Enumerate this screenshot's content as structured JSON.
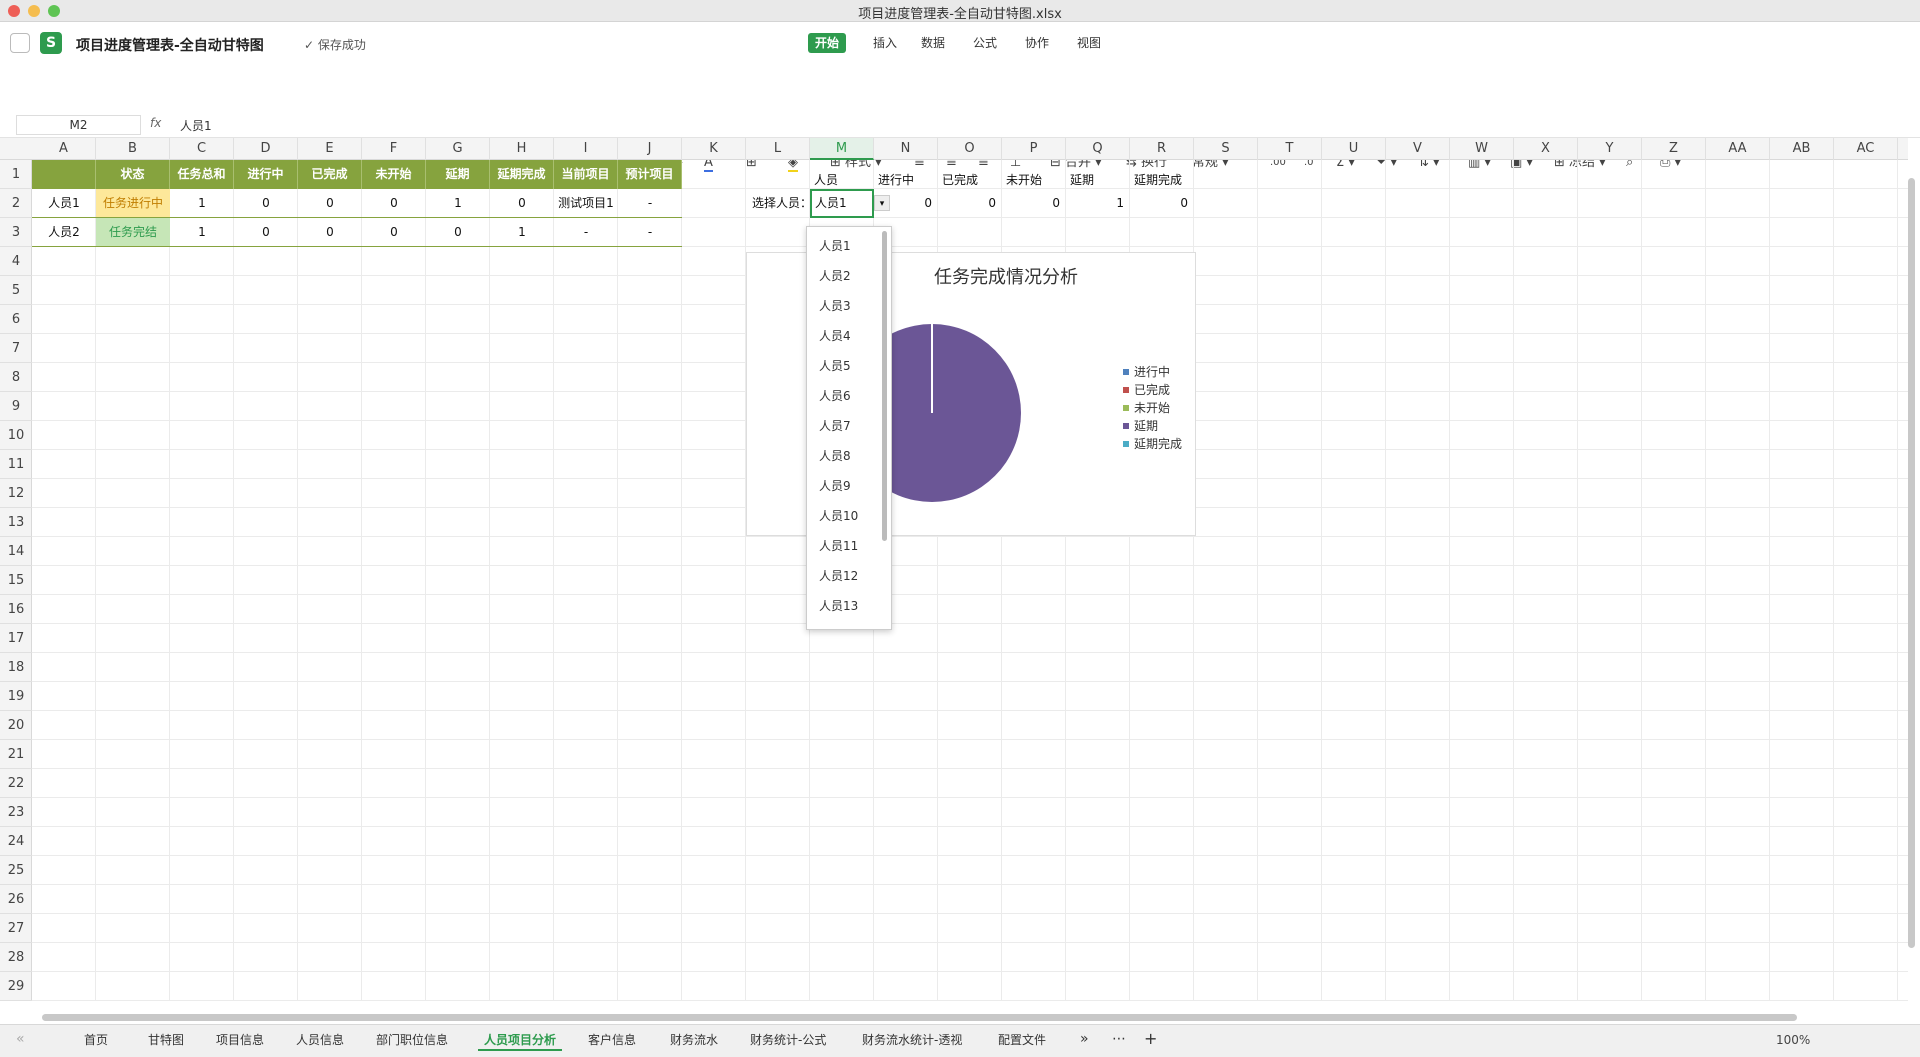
{
  "window": {
    "title": "项目进度管理表-全自动甘特图.xlsx"
  },
  "app": {
    "doc_title": "项目进度管理表-全自动甘特图",
    "save_status": "保存成功",
    "logo": "S"
  },
  "menu_tabs": [
    "开始",
    "插入",
    "数据",
    "公式",
    "协作",
    "视图"
  ],
  "toolbar": {
    "font": "Arial",
    "size": "10",
    "style_label": "样式",
    "merge_label": "合并",
    "wrap_label": "换行",
    "format": "常规",
    "freeze_label": "冻结"
  },
  "formula": {
    "cell": "M2",
    "fx": "fx",
    "value": "人员1"
  },
  "columns": [
    "A",
    "B",
    "C",
    "D",
    "E",
    "F",
    "G",
    "H",
    "I",
    "J",
    "K",
    "L",
    "M",
    "N",
    "O",
    "P",
    "Q",
    "R",
    "S",
    "T",
    "U",
    "V",
    "W",
    "X",
    "Y",
    "Z",
    "AA",
    "AB",
    "AC"
  ],
  "rows": [
    "1",
    "2",
    "3",
    "4",
    "5",
    "6",
    "7",
    "8",
    "9",
    "10",
    "11",
    "12",
    "13",
    "14",
    "15",
    "16",
    "17",
    "18",
    "19",
    "20",
    "21",
    "22",
    "23",
    "24",
    "25",
    "26",
    "27",
    "28",
    "29"
  ],
  "table": {
    "headers": [
      "",
      "状态",
      "任务总和",
      "进行中",
      "已完成",
      "未开始",
      "延期",
      "延期完成",
      "当前项目",
      "预计项目"
    ],
    "rows": [
      [
        "人员1",
        "任务进行中",
        "1",
        "0",
        "0",
        "0",
        "1",
        "0",
        "测试项目1",
        "-"
      ],
      [
        "人员2",
        "任务完结",
        "1",
        "0",
        "0",
        "0",
        "0",
        "1",
        "-",
        "-"
      ]
    ]
  },
  "summary": {
    "headers": [
      "人员",
      "进行中",
      "已完成",
      "未开始",
      "延期",
      "延期完成"
    ],
    "label": "选择人员：",
    "person": "人员1",
    "values": [
      "0",
      "0",
      "0",
      "1",
      "0"
    ]
  },
  "dropdown": [
    "人员1",
    "人员2",
    "人员3",
    "人员4",
    "人员5",
    "人员6",
    "人员7",
    "人员8",
    "人员9",
    "人员10",
    "人员11",
    "人员12",
    "人员13"
  ],
  "chart_data": {
    "type": "pie",
    "title": "任务完成情况分析",
    "categories": [
      "进行中",
      "已完成",
      "未开始",
      "延期",
      "延期完成"
    ],
    "values": [
      0,
      0,
      0,
      1,
      0
    ],
    "colors": [
      "#4f81bd",
      "#c0504d",
      "#9bbb59",
      "#6b5696",
      "#4bacc6"
    ],
    "legend": "right"
  },
  "sheets": [
    "首页",
    "甘特图",
    "项目信息",
    "人员信息",
    "部门职位信息",
    "人员项目分析",
    "客户信息",
    "财务流水",
    "财务统计-公式",
    "财务流水统计-透视",
    "配置文件"
  ],
  "active_sheet": "人员项目分析",
  "zoom": "100%"
}
